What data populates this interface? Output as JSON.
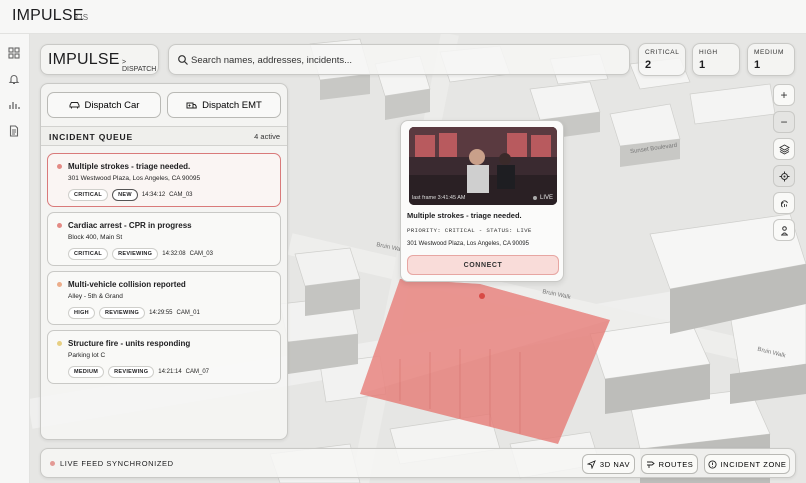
{
  "app": {
    "title": "IMPULSE",
    "subtitle": "OS"
  },
  "rail": {
    "icons": [
      "grid-icon",
      "bell-icon",
      "chart-icon",
      "document-icon"
    ]
  },
  "brand": {
    "name": "IMPULSE",
    "tag": "> DISPATCH"
  },
  "search": {
    "placeholder": "Search names, addresses, incidents..."
  },
  "stats": [
    {
      "label": "CRITICAL",
      "value": "2"
    },
    {
      "label": "HIGH",
      "value": "1"
    },
    {
      "label": "MEDIUM",
      "value": "1"
    }
  ],
  "panel": {
    "dispatch_car": "Dispatch Car",
    "dispatch_emt": "Dispatch EMT",
    "queue_title": "INCIDENT QUEUE",
    "queue_count": "4 active"
  },
  "incidents": [
    {
      "title": "Multiple strokes - triage needed.",
      "address": "301 Westwood Plaza, Los Angeles, CA 90095",
      "priority": "CRITICAL",
      "status": "NEW",
      "time": "14:34:12",
      "cam": "CAM_03",
      "dot_color": "#e38a84"
    },
    {
      "title": "Cardiac arrest - CPR in progress",
      "address": "Block 400, Main St",
      "priority": "CRITICAL",
      "status": "REVIEWING",
      "time": "14:32:08",
      "cam": "CAM_03",
      "dot_color": "#e38a84"
    },
    {
      "title": "Multi-vehicle collision reported",
      "address": "Alley - 5th & Grand",
      "priority": "HIGH",
      "status": "REVIEWING",
      "time": "14:29:55",
      "cam": "CAM_01",
      "dot_color": "#ecad8a"
    },
    {
      "title": "Structure fire - units responding",
      "address": "Parking lot C",
      "priority": "MEDIUM",
      "status": "REVIEWING",
      "time": "14:21:14",
      "cam": "CAM_07",
      "dot_color": "#e7cf82"
    }
  ],
  "popup": {
    "feed_timestamp": "last frame 3:41:45 AM",
    "live_label": "LIVE",
    "title": "Multiple strokes - triage needed.",
    "priority_line": "PRIORITY: CRITICAL - STATUS: LIVE",
    "address": "301 Westwood Plaza, Los Angeles, CA 90095",
    "connect": "CONNECT"
  },
  "tools": [
    "zoom-in-icon",
    "zoom-out-icon",
    "layers-icon",
    "locate-icon",
    "fingerprint-icon",
    "person-pin-icon"
  ],
  "tool_glyphs": {
    "zoom_in": "+",
    "zoom_out": "−"
  },
  "streets": [
    "Bruin Walk",
    "Bruin Walk",
    "Bruin Walk",
    "Sunset Boulevard"
  ],
  "bottom": {
    "sync": "LIVE FEED SYNCHRONIZED",
    "nav3d": "3D NAV",
    "routes": "ROUTES",
    "incident_zone": "INCIDENT ZONE"
  },
  "colors": {
    "critical": "#e38a84",
    "zone_fill": "#e57d78",
    "accent_border": "#d97a7a"
  }
}
